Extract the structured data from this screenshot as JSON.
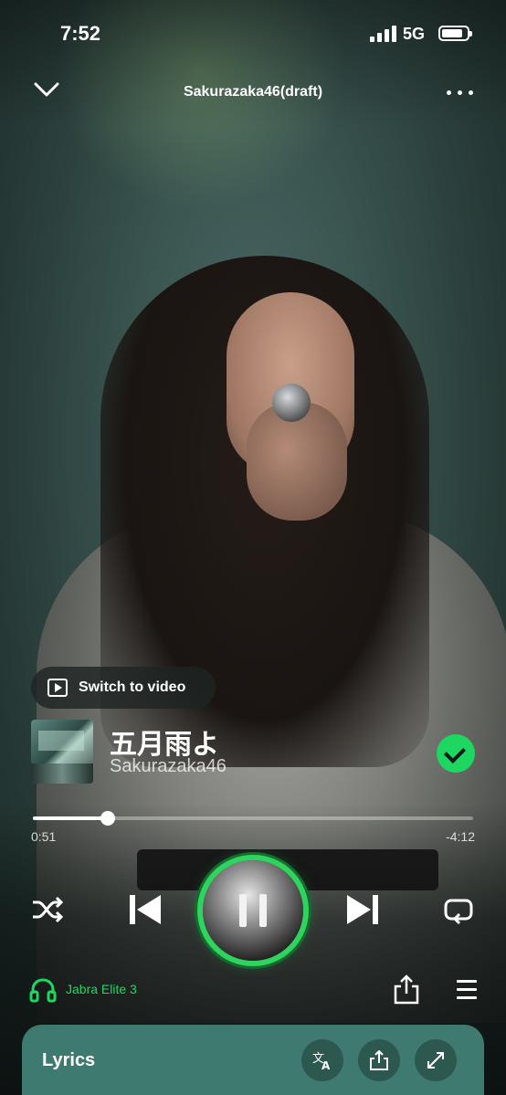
{
  "status_bar": {
    "time": "7:52",
    "network": "5G"
  },
  "header": {
    "title": "Sakurazaka46(draft)"
  },
  "video_toggle": {
    "label": "Switch to video"
  },
  "track": {
    "title": "五月雨よ",
    "artist": "Sakurazaka46",
    "liked": true
  },
  "playback": {
    "elapsed": "0:51",
    "remaining": "-4:12",
    "progress_fraction": 0.17,
    "is_playing": true
  },
  "output_device": {
    "name": "Jabra Elite 3"
  },
  "lyrics_card": {
    "title": "Lyrics"
  },
  "colors": {
    "accent": "#1ed760",
    "lyrics_card": "#3e7a6f"
  },
  "icons": [
    "chevron-down-icon",
    "more-icon",
    "video-icon",
    "check-icon",
    "shuffle-icon",
    "previous-icon",
    "pause-icon",
    "next-icon",
    "repeat-icon",
    "headphones-icon",
    "share-icon",
    "queue-icon",
    "translate-icon",
    "expand-icon"
  ]
}
